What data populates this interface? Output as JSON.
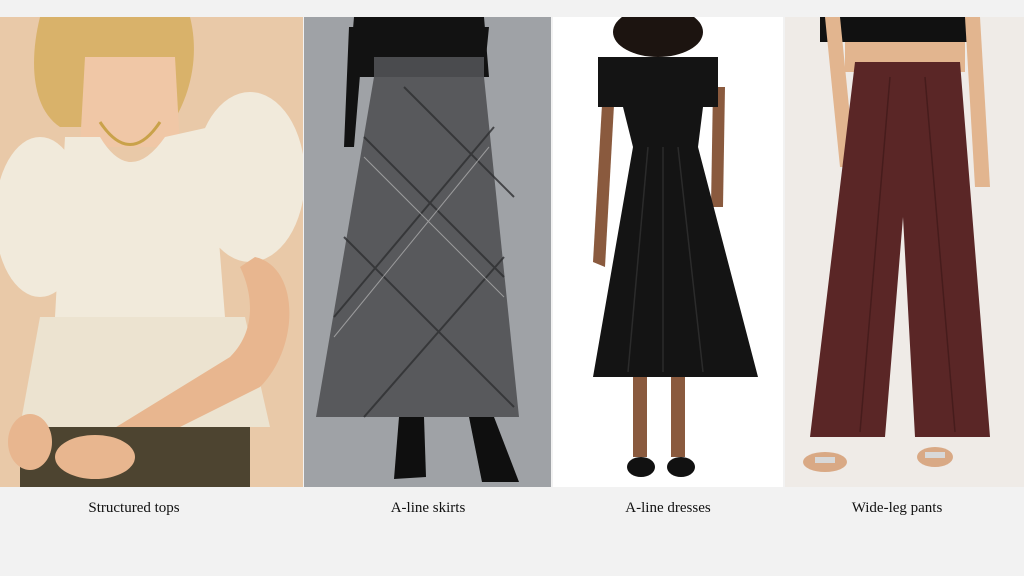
{
  "items": [
    {
      "caption": "Structured tops",
      "garment": "cream puff-sleeve peplum top"
    },
    {
      "caption": "A-line skirts",
      "garment": "grey plaid maxi skirt"
    },
    {
      "caption": "A-line dresses",
      "garment": "black midi dress"
    },
    {
      "caption": "Wide-leg pants",
      "garment": "brown wide-leg trousers"
    }
  ],
  "colors": {
    "background": "#f2f2f2",
    "panel1_bg": "#e9c9a8",
    "panel2_bg": "#9fa2a6",
    "panel3_bg": "#ffffff",
    "panel4_bg": "#efebe7",
    "top_cream": "#f1eadb",
    "skirt_grey": "#58595c",
    "dress_black": "#141414",
    "pants_brown": "#5a2626"
  }
}
